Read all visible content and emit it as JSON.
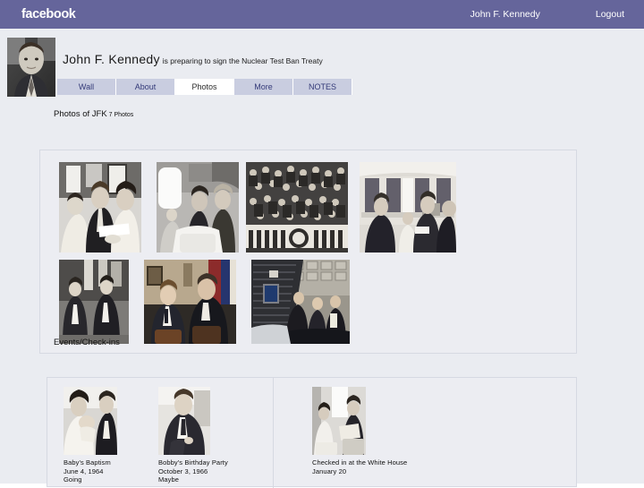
{
  "topbar": {
    "brand": "facebook",
    "user_name": "John F. Kennedy",
    "logout_label": "Logout",
    "bg_color": "#65659b"
  },
  "profile": {
    "name": "John F. Kennedy",
    "status": "is preparing to sign the Nuclear Test Ban Treaty",
    "avatar_alt": "john-f-kennedy-portrait"
  },
  "tabs": [
    {
      "label": "Wall",
      "active": false
    },
    {
      "label": "About",
      "active": false
    },
    {
      "label": "Photos",
      "active": true
    },
    {
      "label": "More",
      "active": false
    },
    {
      "label": "NOTES",
      "active": false
    }
  ],
  "photos_section": {
    "title": "Photos of JFK",
    "count_label": "7 Photos",
    "photos": [
      {
        "alt": "jfk-and-jackie-with-woman-indoors",
        "tone": "bw"
      },
      {
        "alt": "jfk-and-jackie-seated-on-plane",
        "tone": "bw"
      },
      {
        "alt": "joint-session-of-congress-crowd",
        "tone": "bw"
      },
      {
        "alt": "oval-office-meeting-with-officials",
        "tone": "bw"
      },
      {
        "alt": "two-men-walking-outdoors",
        "tone": "bw"
      },
      {
        "alt": "jfk-seated-talking-with-man-in-office",
        "tone": "color"
      },
      {
        "alt": "jfk-inspecting-space-capsule-with-crowd",
        "tone": "color"
      }
    ]
  },
  "events_section": {
    "title": "Events/Check-ins",
    "events": [
      {
        "name": "Baby's Baptism",
        "date": "June 4, 1964",
        "rsvp": "Going",
        "alt": "jackie-holding-baby-with-jfk"
      },
      {
        "name": "Bobby's Birthday Party",
        "date": "October 3, 1966",
        "rsvp": "Maybe",
        "alt": "bobby-kennedy-seated-in-suit"
      }
    ],
    "checkins": [
      {
        "name": "Checked in at the White House",
        "date": "January 20",
        "rsvp": "",
        "alt": "white-house-interior-with-two-people"
      }
    ]
  }
}
